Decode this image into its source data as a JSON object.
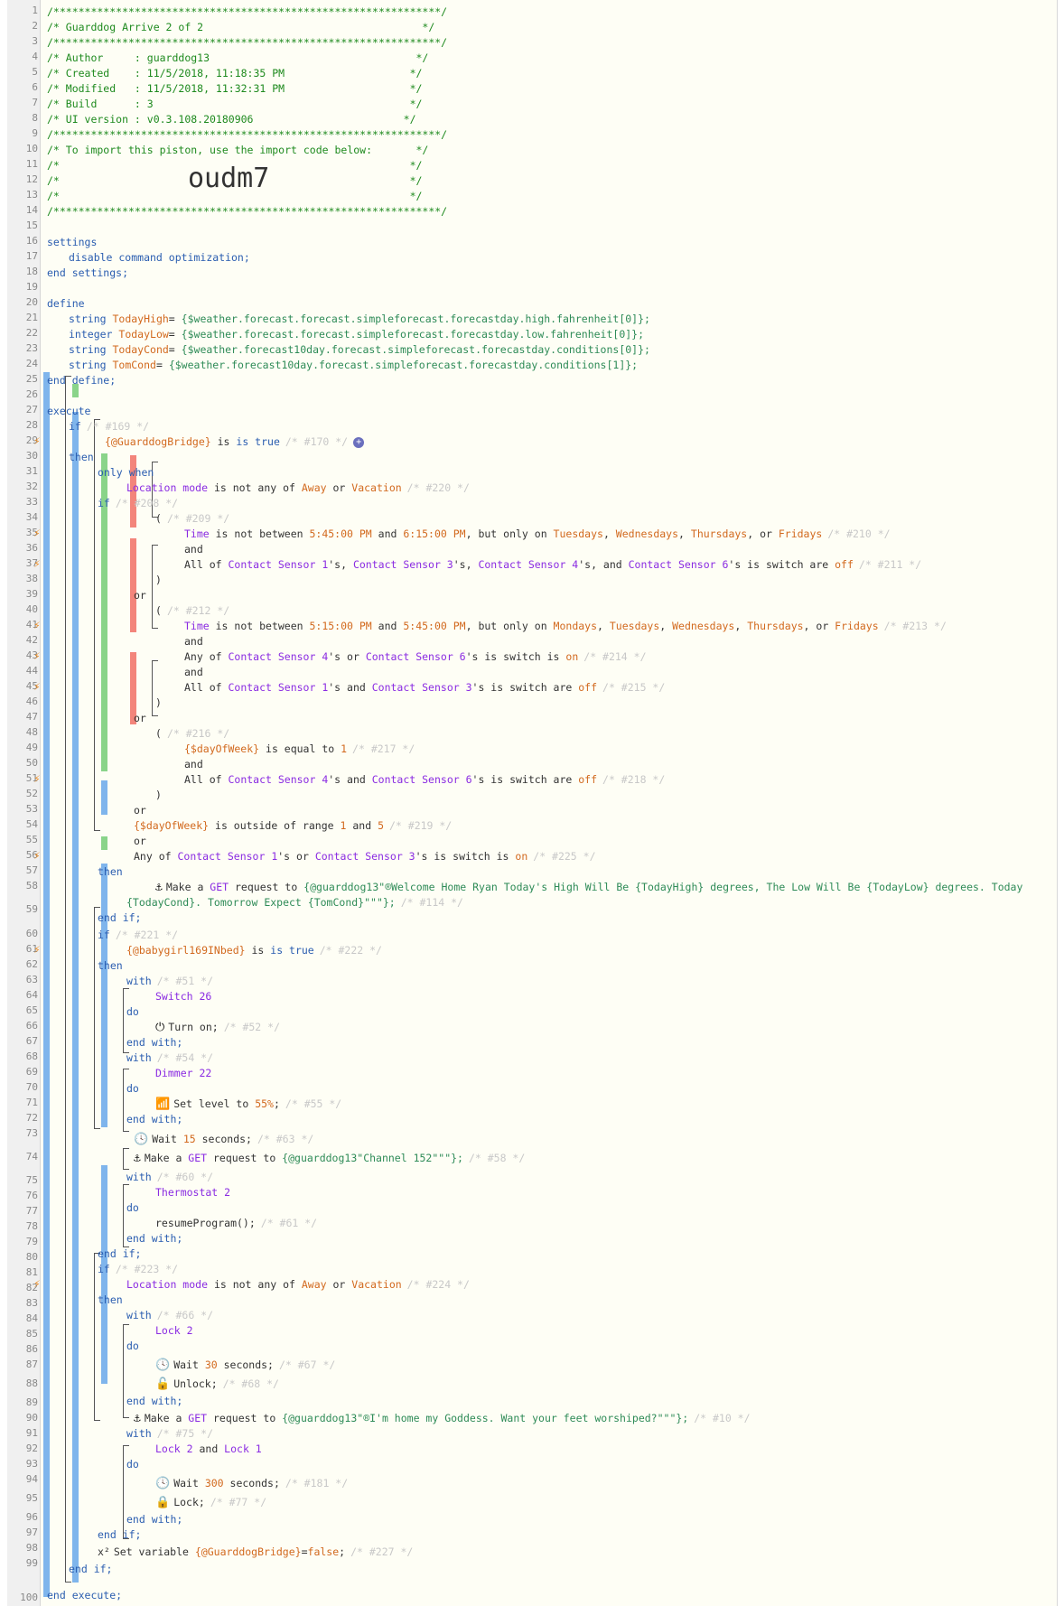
{
  "header": {
    "border": "/**************************************************************/",
    "title": "/* Guarddog Arrive 2 of 2                                   */",
    "author": "/* Author     : guarddog13                                 */",
    "created": "/* Created    : 11/5/2018, 11:18:35 PM                    */",
    "modified": "/* Modified   : 11/5/2018, 11:32:31 PM                    */",
    "build": "/* Build      : 3                                         */",
    "ui": "/* UI version : v0.3.108.20180906                        */",
    "import": "/* To import this piston, use the import code below:       */",
    "empty": "/*                                                        */",
    "code": "oudm7"
  },
  "settings": {
    "open": "settings",
    "line": "disable command optimization;",
    "close": "end settings;"
  },
  "define": {
    "open": "define",
    "close": "end define;",
    "vars": [
      {
        "type": "string",
        "name": "TodayHigh",
        "expr": "{$weather.forecast.forecast.simpleforecast.forecastday.high.fahrenheit[0]};"
      },
      {
        "type": "integer",
        "name": "TodayLow",
        "expr": "{$weather.forecast.forecast.simpleforecast.forecastday.low.fahrenheit[0]};"
      },
      {
        "type": "string",
        "name": "TodayCond",
        "expr": "{$weather.forecast10day.forecast.simpleforecast.forecastday.conditions[0]};"
      },
      {
        "type": "string",
        "name": "TomCond",
        "expr": "{$weather.forecast10day.forecast.simpleforecast.forecastday.conditions[1]};"
      }
    ]
  },
  "kw": {
    "execute": "execute",
    "end_execute": "end execute;",
    "if": "if",
    "then": "then",
    "end_if": "end if;",
    "only_when": "only when",
    "or": "or",
    "and": "and",
    "with": "with",
    "do": "do",
    "end_with": "end with;",
    "paren_open": "(",
    "paren_close": ")",
    "is_true": "is true",
    "eq": "=",
    "semi": ";"
  },
  "ids": {
    "i169": "/* #169 */",
    "i170": "/* #170 */",
    "i220": "/* #220 */",
    "i208": "/* #208 */",
    "i209": "/* #209 */",
    "i210": "/* #210 */",
    "i211": "/* #211 */",
    "i212": "/* #212 */",
    "i213": "/* #213 */",
    "i214": "/* #214 */",
    "i215": "/* #215 */",
    "i216": "/* #216 */",
    "i217": "/* #217 */",
    "i218": "/* #218 */",
    "i219": "/* #219 */",
    "i225": "/* #225 */",
    "i114": "/* #114 */",
    "i221": "/* #221 */",
    "i222": "/* #222 */",
    "i51": "/* #51 */",
    "i52": "/* #52 */",
    "i54": "/* #54 */",
    "i55": "/* #55 */",
    "i63": "/* #63 */",
    "i58": "/* #58 */",
    "i60": "/* #60 */",
    "i61": "/* #61 */",
    "i223": "/* #223 */",
    "i224": "/* #224 */",
    "i66": "/* #66 */",
    "i67": "/* #67 */",
    "i68": "/* #68 */",
    "i10": "/* #10 */",
    "i75": "/* #75 */",
    "i181": "/* #181 */",
    "i77": "/* #77 */",
    "i227": "/* #227 */"
  },
  "text": {
    "guardbridge": "{@GuarddogBridge}",
    "loc_mode": "Location mode",
    "not_any": " is not any of ",
    "away": "Away",
    "or_w": " or ",
    "vacation": "Vacation",
    "time": "Time",
    "not_between": " is not between ",
    "t1a": "5:45:00 PM",
    "t1b": "6:15:00 PM",
    "and_w": " and ",
    "but_only": ", but only on ",
    "tue": "Tuesdays",
    "wed": "Wednesdays",
    "thu": "Thursdays",
    "or_c": ", or ",
    "fri": "Fridays",
    "all_of": "All of ",
    "any_of": "Any of ",
    "cs1": "Contact Sensor 1",
    "cs3": "Contact Sensor 3",
    "cs4": "Contact Sensor 4",
    "cs6": "Contact Sensor 6",
    "poss": "'s",
    "poss_c": "'s, ",
    "poss_and": "'s, and ",
    "switch": "switch",
    "are": " are ",
    "is_w": " is ",
    "off": "off",
    "on": "on",
    "t2a": "5:15:00 PM",
    "t2b": "5:45:00 PM",
    "mon": "Mondays",
    "sep": ", ",
    "dow": "{$dayOfWeek}",
    "eq_to": " is equal to ",
    "one": "1",
    "outside": " is outside of range ",
    "five": "5",
    "make_get": "Make a ",
    "get": "GET",
    "req_to": " request to ",
    "gd13": "{@guarddog13",
    "msg1a": "\"®Welcome Home Ryan Today's High Will Be {TodayHigh} degrees, The Low Will Be {TodayLow} degrees. Today",
    "msg1b": "{TodayCond}. Tomorrow Expect {TomCond}\"\"\"};",
    "babygirl": "{@babygirl169INbed}",
    "switch26": "Switch 26",
    "turn_on": "Turn on;",
    "dimmer22": "Dimmer 22",
    "set_level": "Set level to ",
    "pct": "55%",
    "wait": "Wait ",
    "n15": "15",
    "seconds": " seconds;",
    "ch152": "\"Channel 152\"\"\"};",
    "thermo": "Thermostat 2",
    "resume": "resumeProgram();",
    "lock2": "Lock 2",
    "n30": "30",
    "unlock": "Unlock;",
    "msg2": "\"®I'm home my Goddess. Want your feet worshiped?\"\"\"};",
    "lock1": "Lock 1",
    "n300": "300",
    "lock": "Lock;",
    "setvar": "Set variable ",
    "false": "false",
    "semi": ";"
  },
  "icons": {
    "bolt": "⚡",
    "anchor": "⚓",
    "power": "⏻",
    "signal": "📶",
    "clock": "🕓",
    "unlock": "🔓",
    "lock": "🔒",
    "x2": "x²",
    "plus": "+"
  },
  "colors": {
    "comment": "#1e8a1e",
    "keyword": "#2a5db0",
    "device": "#8a2be2",
    "value": "#d2691e",
    "string": "#2e8b57"
  }
}
